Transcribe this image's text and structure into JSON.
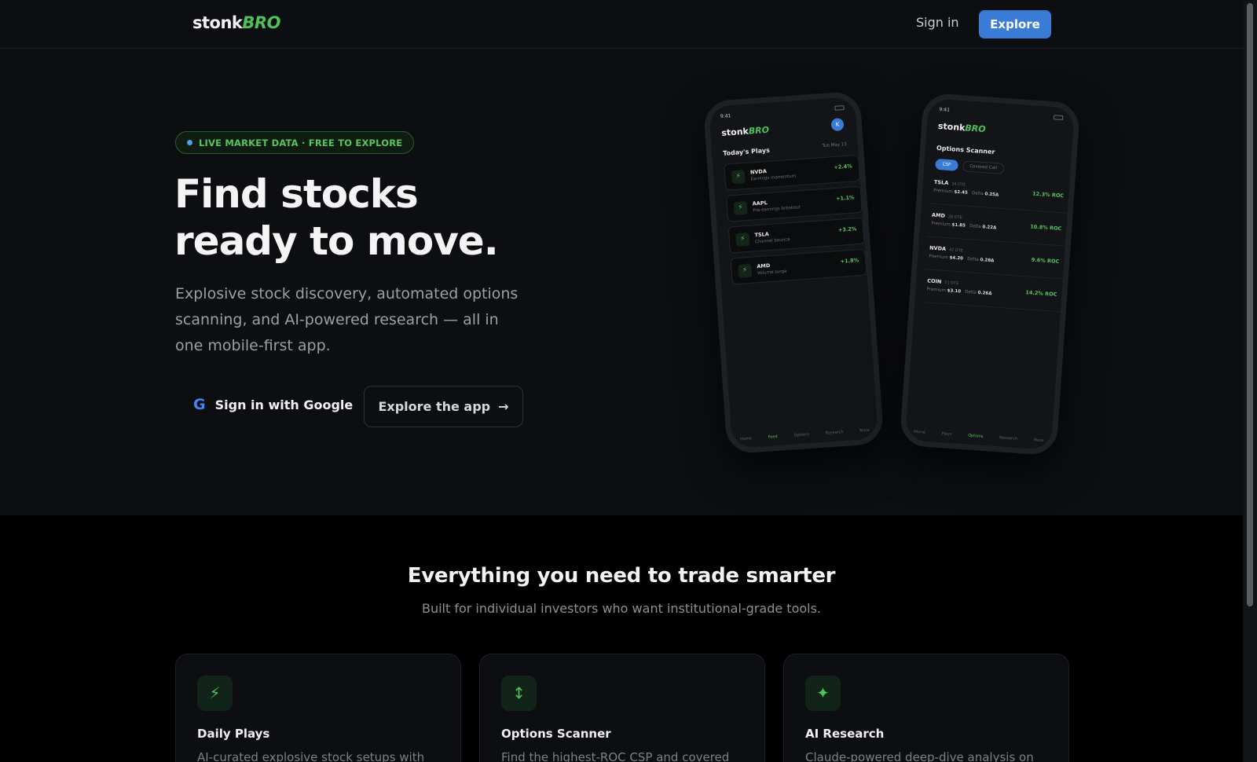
{
  "nav": {
    "logo_stonk": "stonk",
    "logo_bro": "BRO",
    "signin_label": "Sign in",
    "explore_label": "Explore"
  },
  "hero": {
    "badge": "LIVE MARKET DATA · FREE TO EXPLORE",
    "title_line1": "Find stocks",
    "title_line2": "ready to move.",
    "subtitle": "Explosive stock discovery, automated options scanning, and AI-powered research — all in one mobile-first app.",
    "google_button": "Sign in with Google",
    "google_icon": "G",
    "explore_button": "Explore the app",
    "explore_arrow": "→"
  },
  "phone1": {
    "time": "9:41",
    "logo_stonk": "stonk",
    "logo_bro": "BRO",
    "avatar": "K",
    "heading": "Today's Plays",
    "date": "Tue May 13",
    "plays": [
      {
        "ticker": "NVDA",
        "desc": "Earnings momentum",
        "change": "+2.4%",
        "icon": "⚡"
      },
      {
        "ticker": "AAPL",
        "desc": "Pre-earnings breakout",
        "change": "+1.1%",
        "icon": "⚡"
      },
      {
        "ticker": "TSLA",
        "desc": "Channel bounce",
        "change": "+3.2%",
        "icon": "⚡"
      },
      {
        "ticker": "AMD",
        "desc": "Volume surge",
        "change": "+1.8%",
        "icon": "⚡"
      }
    ],
    "tabs": [
      "Home",
      "Feed",
      "Options",
      "Research",
      "More"
    ]
  },
  "phone2": {
    "time": "9:41",
    "logo_stonk": "stonk",
    "logo_bro": "BRO",
    "heading": "Options Scanner",
    "chip_on": "CSP",
    "chip_off": "Covered Call",
    "options": [
      {
        "ticker": "TSLA",
        "dte": "34 DTE",
        "premium_label": "Premium",
        "premium": "$2.45",
        "delta_label": "Delta",
        "delta": "0.25Δ",
        "roc": "12.3% ROC"
      },
      {
        "ticker": "AMD",
        "dte": "28 DTE",
        "premium_label": "Premium",
        "premium": "$1.85",
        "delta_label": "Delta",
        "delta": "0.22Δ",
        "roc": "10.8% ROC"
      },
      {
        "ticker": "NVDA",
        "dte": "42 DTE",
        "premium_label": "Premium",
        "premium": "$4.20",
        "delta_label": "Delta",
        "delta": "0.28Δ",
        "roc": "9.6% ROC"
      },
      {
        "ticker": "COIN",
        "dte": "21 DTE",
        "premium_label": "Premium",
        "premium": "$3.10",
        "delta_label": "Delta",
        "delta": "0.26Δ",
        "roc": "14.2% ROC"
      }
    ],
    "tabs": [
      "Home",
      "Plays",
      "Options",
      "Research",
      "More"
    ]
  },
  "features": {
    "title": "Everything you need to trade smarter",
    "subtitle": "Built for individual investors who want institutional-grade tools.",
    "cards": [
      {
        "icon": "⚡",
        "icon_name": "bolt-icon",
        "title": "Daily Plays",
        "desc": "AI-curated explosive stock setups with"
      },
      {
        "icon": "↕",
        "icon_name": "up-down-arrow-icon",
        "title": "Options Scanner",
        "desc": "Find the highest-ROC CSP and covered"
      },
      {
        "icon": "✦",
        "icon_name": "sparkles-icon",
        "title": "AI Research",
        "desc": "Claude-powered deep-dive analysis on"
      }
    ]
  },
  "colors": {
    "accent_green": "#4ec15a",
    "accent_blue": "#3a7bd5",
    "background": "#0c0e11"
  }
}
